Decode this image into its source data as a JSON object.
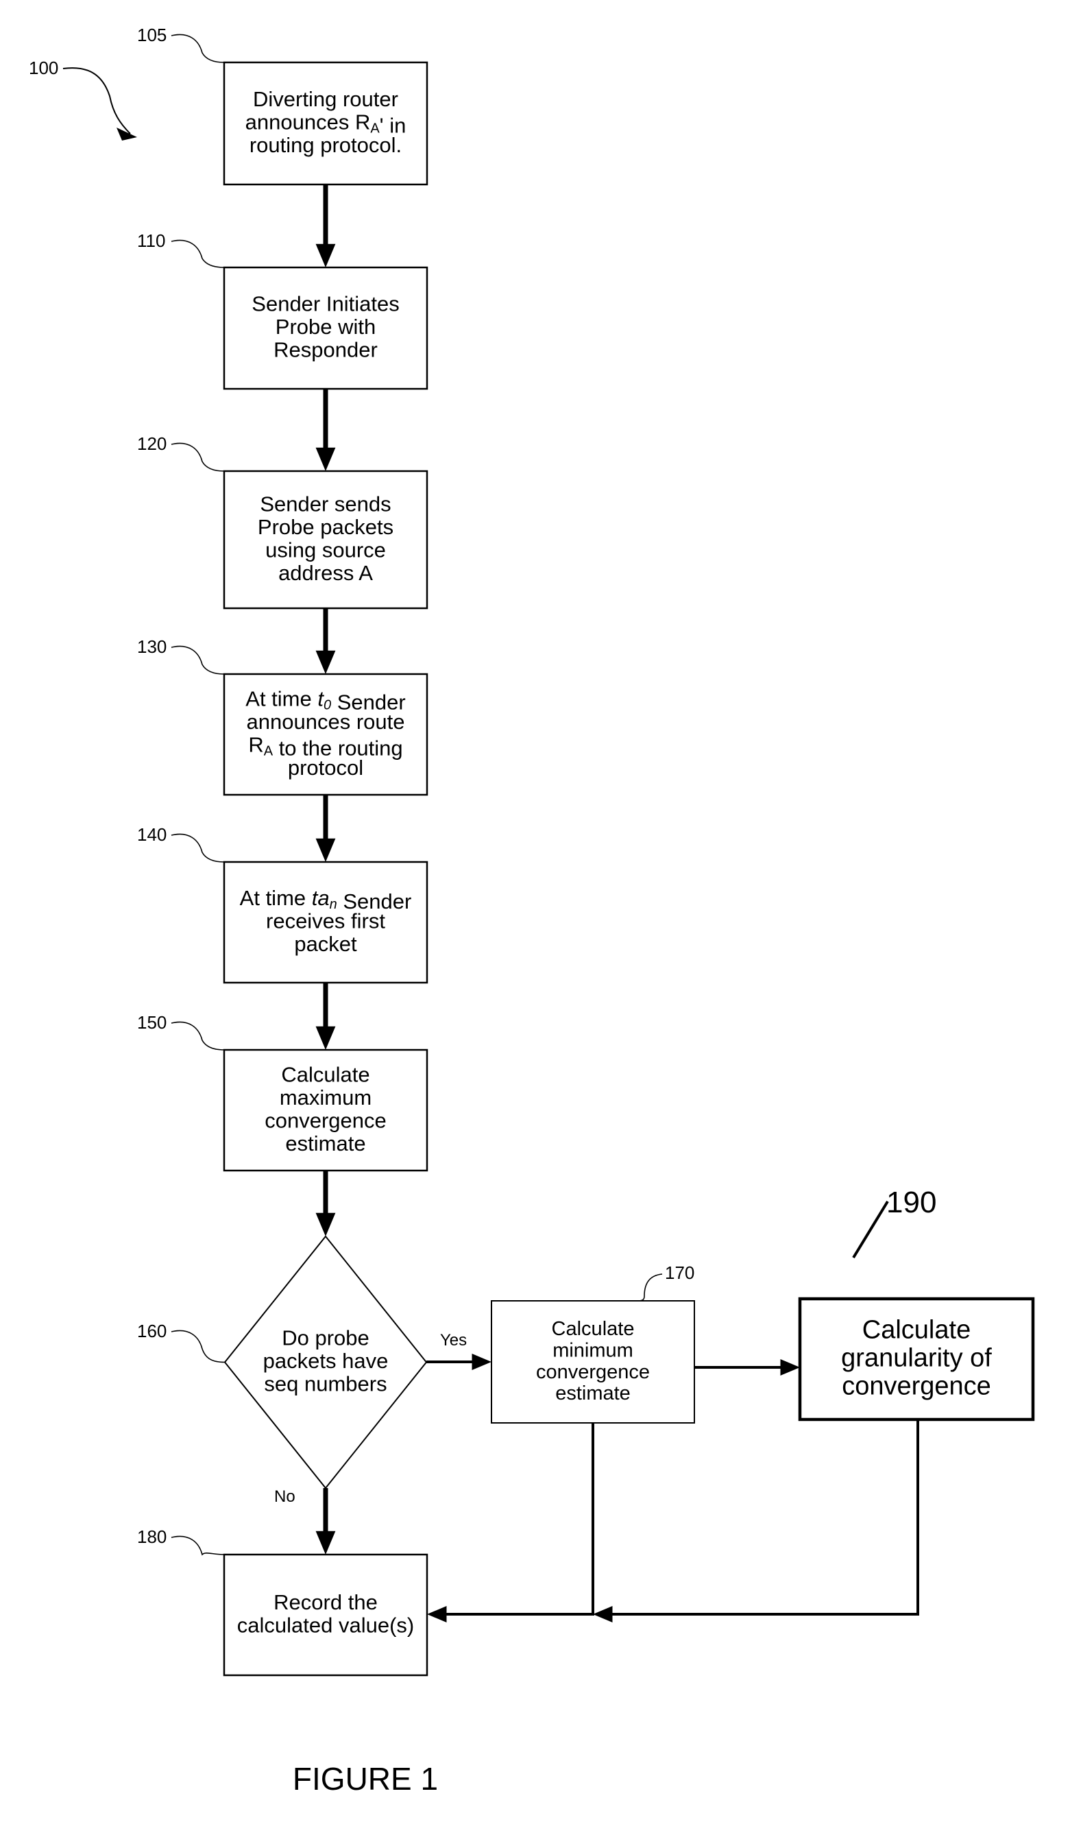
{
  "figure": {
    "number": "100",
    "caption": "FIGURE 1"
  },
  "steps": [
    {
      "id": "105",
      "type": "process",
      "lines": [
        "Diverting router",
        "announces Rₐ' in",
        "routing protocol."
      ],
      "rich": [
        [
          "Diverting router"
        ],
        [
          "announces R",
          {
            "sub": "A"
          },
          "' in"
        ],
        [
          "routing protocol."
        ]
      ]
    },
    {
      "id": "110",
      "type": "process",
      "lines": [
        "Sender Initiates",
        "Probe with",
        "Responder"
      ]
    },
    {
      "id": "120",
      "type": "process",
      "lines": [
        "Sender sends",
        "Probe packets",
        "using source",
        "address A"
      ]
    },
    {
      "id": "130",
      "type": "process",
      "lines": [
        "At time t0 Sender",
        "announces route",
        "RA to the routing",
        "protocol"
      ],
      "rich": [
        [
          "At time ",
          {
            "i": "t"
          },
          {
            "sub": "0",
            "i": true
          },
          " Sender"
        ],
        [
          "announces route"
        ],
        [
          "R",
          {
            "sub": "A"
          },
          " to the routing"
        ],
        [
          "protocol"
        ]
      ]
    },
    {
      "id": "140",
      "type": "process",
      "lines": [
        "At time tan Sender",
        "receives first",
        "packet"
      ],
      "rich": [
        [
          "At time ",
          {
            "i": "ta"
          },
          {
            "sub": "n",
            "i": true
          },
          " Sender"
        ],
        [
          "receives first"
        ],
        [
          "packet"
        ]
      ]
    },
    {
      "id": "150",
      "type": "process",
      "lines": [
        "Calculate",
        "maximum",
        "convergence",
        "estimate"
      ]
    },
    {
      "id": "160",
      "type": "decision",
      "lines": [
        "Do probe",
        "packets have",
        "seq numbers"
      ]
    },
    {
      "id": "170",
      "type": "process",
      "lines": [
        "Calculate",
        "minimum",
        "convergence",
        "estimate"
      ]
    },
    {
      "id": "180",
      "type": "process",
      "lines": [
        "Record the",
        "calculated value(s)"
      ]
    },
    {
      "id": "190",
      "type": "process",
      "lines": [
        "Calculate",
        "granularity of",
        "convergence"
      ]
    }
  ],
  "branches": {
    "yes": "Yes",
    "no": "No"
  },
  "connections": [
    {
      "from": "105",
      "to": "110"
    },
    {
      "from": "110",
      "to": "120"
    },
    {
      "from": "120",
      "to": "130"
    },
    {
      "from": "130",
      "to": "140"
    },
    {
      "from": "140",
      "to": "150"
    },
    {
      "from": "150",
      "to": "160"
    },
    {
      "from": "160",
      "to": "170",
      "label": "Yes"
    },
    {
      "from": "160",
      "to": "180",
      "label": "No"
    },
    {
      "from": "170",
      "to": "190"
    },
    {
      "from": "170",
      "to": "180"
    },
    {
      "from": "190",
      "to": "180"
    }
  ]
}
